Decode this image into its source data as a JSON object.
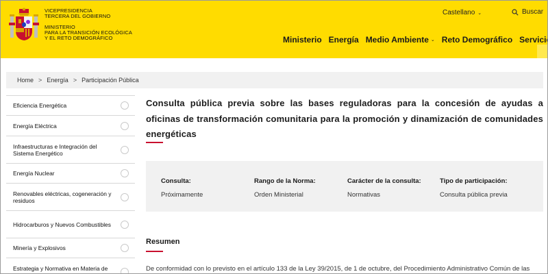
{
  "header": {
    "colors": {
      "background": "#ffdc00",
      "accent_red": "#c8102e"
    },
    "logo_icon": "coat-of-arms-of-spain",
    "gov_lines_1": [
      "VICEPRESIDENCIA",
      "TERCERA DEL GOBIERNO"
    ],
    "gov_lines_2": [
      "MINISTERIO",
      "PARA LA TRANSICIÓN ECOLÓGICA",
      "Y EL RETO DEMOGRÁFICO"
    ],
    "language": "Castellano",
    "search_label": "Buscar",
    "nav": [
      {
        "label": "Ministerio",
        "has_menu": false
      },
      {
        "label": "Energía",
        "has_menu": false
      },
      {
        "label": "Medio Ambiente",
        "has_menu": true
      },
      {
        "label": "Reto Demográfico",
        "has_menu": false
      },
      {
        "label": "Servicios",
        "has_menu": true
      }
    ]
  },
  "breadcrumb": [
    "Home",
    "Energía",
    "Participación Pública"
  ],
  "sidebar": {
    "items": [
      "Eficiencia Energética",
      "Energía Eléctrica",
      "Infraestructuras e Integración del Sistema Energético",
      "Energía Nuclear",
      "Renovables eléctricas, cogeneración y residuos",
      "Hidrocarburos y Nuevos Combustibles",
      "Minería y Explosivos",
      "Estrategia y Normativa en Materia de Energía"
    ]
  },
  "main": {
    "title": "Consulta pública previa sobre las bases reguladoras para la concesión de ayudas a oficinas de transformación comunitaria para la promoción y dinamización de comunidades energéticas",
    "info": {
      "consulta_label": "Consulta:",
      "consulta_value": "Próximamente",
      "rango_label": "Rango de la Norma:",
      "rango_value": "Orden Ministerial",
      "caracter_label": "Carácter de la consulta:",
      "caracter_value": "Normativas",
      "tipo_label": "Tipo de participación:",
      "tipo_value": "Consulta pública previa"
    },
    "resumen_heading": "Resumen",
    "resumen_text": "De conformidad con lo previsto en el artículo 133 de la Ley 39/2015, de 1 de octubre, del Procedimiento Administrativo Común de las"
  }
}
